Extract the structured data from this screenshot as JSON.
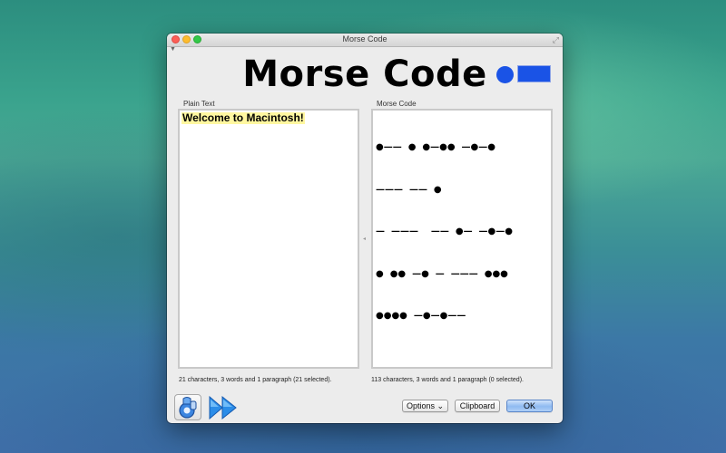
{
  "window": {
    "title": "Morse Code"
  },
  "header": {
    "app_title": "Morse Code",
    "logo_icon": "morse-dot-dash-icon",
    "logo_color": "#1a53e6"
  },
  "plain_pane": {
    "label": "Plain Text",
    "text": "Welcome to Macintosh!",
    "highlight_color": "#fff7a0",
    "status": "21 characters, 3 words and 1 paragraph (21 selected)."
  },
  "morse_pane": {
    "label": "Morse Code",
    "lines": [
      "●——  ●  ●—●●  —●—●",
      "———  ——  ●",
      "—  ———    ——  ●—  —●—●",
      "●  ●●  —●  —  ———  ●●●",
      "●●●●  —●—●——"
    ],
    "status": "113 characters, 3 words and 1 paragraph (0 selected)."
  },
  "footer": {
    "app_icon": "app-settings-icon",
    "forward_icon": "fast-forward-icon",
    "options_label": "Options",
    "options_chevron": "⌄",
    "clipboard_label": "Clipboard",
    "ok_label": "OK"
  }
}
